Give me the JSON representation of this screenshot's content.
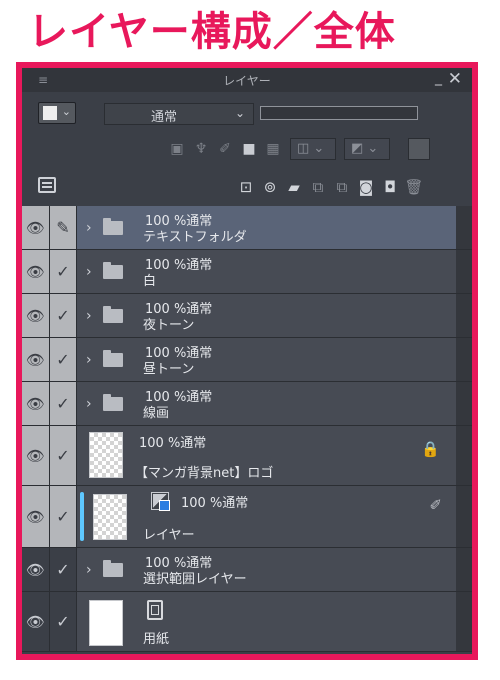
{
  "heading": "レイヤー構成／全体",
  "panel": {
    "title": "レイヤー",
    "grip_glyph": "≡",
    "minimize_glyph": "_",
    "close_glyph": "✕"
  },
  "toolbar": {
    "blend_mode": "通常",
    "dropdown_glyph": "⌄"
  },
  "icons": {
    "eye": "👁",
    "check": "✓",
    "pen": "✎",
    "expand": "›",
    "lock": "🔒"
  },
  "layers": [
    {
      "opacity_mode": "100 %通常",
      "name": "テキストフォルダ",
      "type": "folder",
      "selected": true
    },
    {
      "opacity_mode": "100 %通常",
      "name": "白",
      "type": "folder"
    },
    {
      "opacity_mode": "100 %通常",
      "name": "夜トーン",
      "type": "folder"
    },
    {
      "opacity_mode": "100 %通常",
      "name": "昼トーン",
      "type": "folder"
    },
    {
      "opacity_mode": "100 %通常",
      "name": "線画",
      "type": "folder"
    },
    {
      "opacity_mode": "100 %通常",
      "name": "【マンガ背景net】ロゴ",
      "type": "raster",
      "locked": true
    },
    {
      "opacity_mode": "100 %通常",
      "name": "レイヤー",
      "type": "raster"
    },
    {
      "opacity_mode": "100 %通常",
      "name": "選択範囲レイヤー",
      "type": "folder"
    },
    {
      "opacity_mode": "",
      "name": "用紙",
      "type": "paper"
    }
  ],
  "colors": {
    "accent": "#e8185b",
    "panel_bg": "#3b3f47",
    "selected_row": "#5a6478",
    "highlight_bar": "#5ec8ff"
  }
}
